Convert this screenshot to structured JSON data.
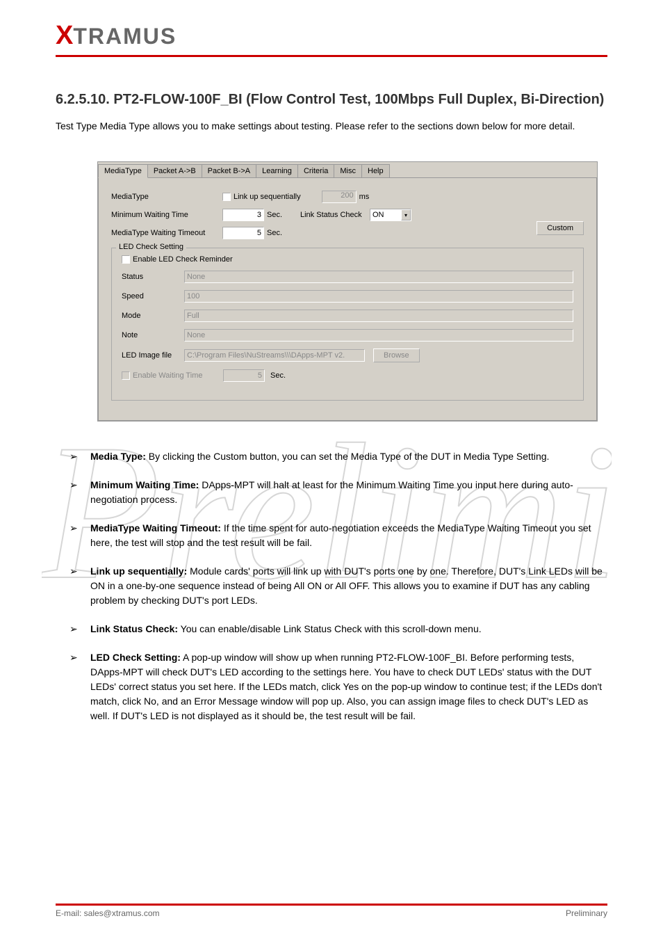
{
  "logo": {
    "x": "X",
    "rest": "TRAMUS"
  },
  "heading": {
    "num": "6.2.5.10.",
    "title": "PT2-FLOW-100F_BI (Flow Control Test, 100Mbps Full Duplex, Bi-Direction)"
  },
  "intro": "Test Type Media Type allows you to make settings about testing. Please refer to the sections down below for more detail.",
  "tabs": [
    "MediaType",
    "Packet A->B",
    "Packet B->A",
    "Learning",
    "Criteria",
    "Misc",
    "Help"
  ],
  "panel": {
    "mediaType": "MediaType",
    "minWait": "Minimum Waiting Time",
    "minWaitVal": "3",
    "sec": "Sec.",
    "mtTimeout": "MediaType Waiting Timeout",
    "mtTimeoutVal": "5",
    "linkSeq": "Link up sequentially",
    "linkSeqVal": "200",
    "ms": "ms",
    "linkStatus": "Link Status Check",
    "linkStatusVal": "ON",
    "custom": "Custom",
    "ledLegend": "LED Check Setting",
    "enableLed": "Enable LED Check Reminder",
    "status": "Status",
    "statusVal": "None",
    "speed": "Speed",
    "speedVal": "100",
    "mode": "Mode",
    "modeVal": "Full",
    "note": "Note",
    "noteVal": "None",
    "ledImg": "LED Image file",
    "ledImgVal": "C:\\Program Files\\NuStreams\\\\\\DApps-MPT v2.",
    "browse": "Browse",
    "enableWait": "Enable Waiting Time",
    "enableWaitVal": "5"
  },
  "bullets": [
    {
      "label": "Media Type:",
      "text": "By clicking the Custom button, you can set the Media Type of the DUT in Media Type Setting."
    },
    {
      "label": "Minimum Waiting Time:",
      "text": "DApps-MPT will halt at least for the Minimum Waiting Time you input here during auto-negotiation process."
    },
    {
      "label": "MediaType Waiting Timeout:",
      "text": "If the time spent for auto-negotiation exceeds the MediaType Waiting Timeout you set here, the test will stop and the test result will be fail."
    },
    {
      "label": "Link up sequentially:",
      "text": "Module cards' ports will link up with DUT's ports one by one. Therefore, DUT's Link LEDs will be ON in a one-by-one sequence instead of being All ON or All OFF. This allows you to examine if DUT has any cabling problem by checking DUT's port LEDs."
    },
    {
      "label": "Link Status Check:",
      "text": "You can enable/disable Link Status Check with this scroll-down menu."
    },
    {
      "label": "LED Check Setting:",
      "text": "A pop-up window will show up when running PT2-FLOW-100F_BI. Before performing tests, DApps-MPT will check DUT's LED according to the settings here. You have to check DUT LEDs' status with the DUT LEDs' correct status you set here. If the LEDs match, click Yes on the pop-up window to continue test; if the LEDs don't match, click No, and an Error Message window will pop up. Also, you can assign image files to check DUT's LED as well. If DUT's LED is not displayed as it should be, the test result will be fail."
    }
  ],
  "footer": {
    "left": "E-mail: sales@xtramus.com",
    "right": "Preliminary"
  }
}
